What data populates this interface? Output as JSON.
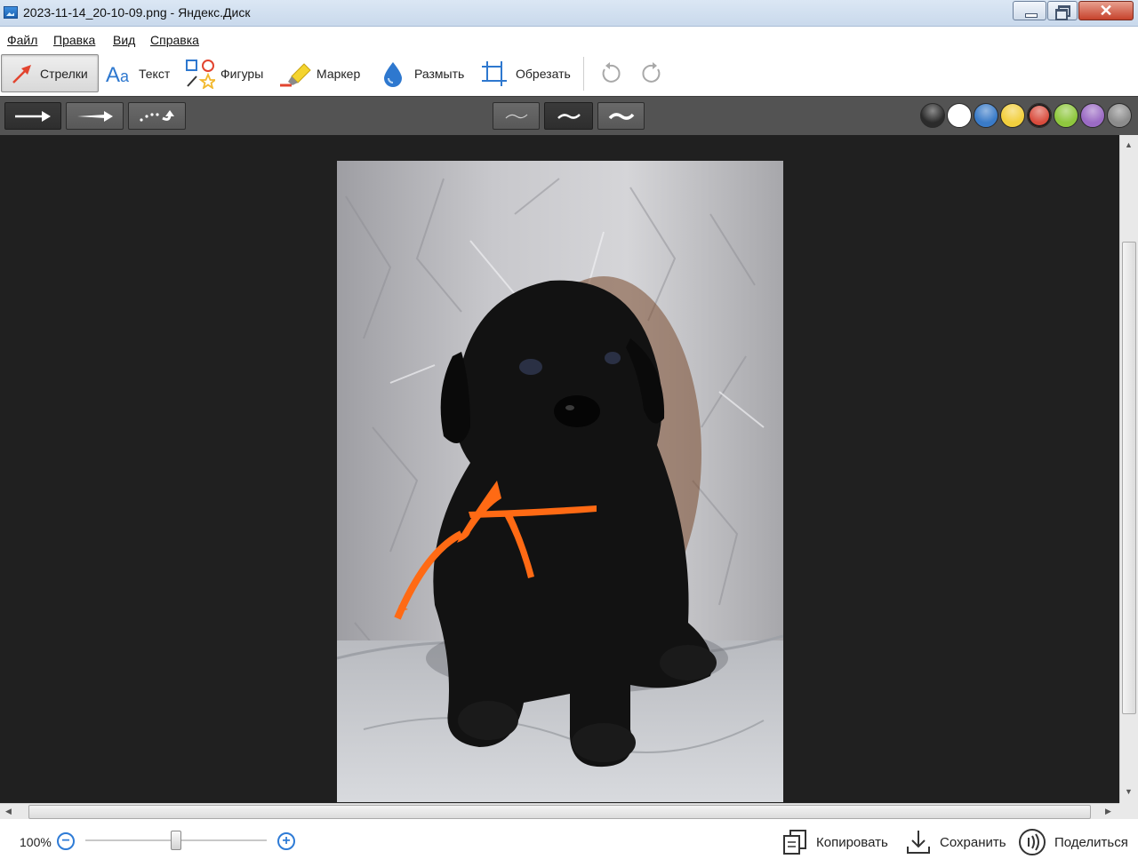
{
  "window": {
    "title": "2023-11-14_20-10-09.png - Яндекс.Диск",
    "close_glyph": "✕"
  },
  "menu": {
    "items": [
      "Файл",
      "Правка",
      "Вид",
      "Справка"
    ]
  },
  "toolbar": {
    "tools": [
      {
        "label": "Стрелки",
        "icon": "arrow-icon",
        "active": true
      },
      {
        "label": "Текст",
        "icon": "text-icon",
        "active": false
      },
      {
        "label": "Фигуры",
        "icon": "shapes-icon",
        "active": false
      },
      {
        "label": "Маркер",
        "icon": "marker-icon",
        "active": false
      },
      {
        "label": "Размыть",
        "icon": "blur-drop-icon",
        "active": false
      },
      {
        "label": "Обрезать",
        "icon": "crop-icon",
        "active": false
      }
    ],
    "history": [
      "undo-icon",
      "redo-icon"
    ]
  },
  "options": {
    "arrow_styles": [
      "straight-arrow",
      "tapered-arrow",
      "dotted-curve-arrow"
    ],
    "selected_arrow_style": 0,
    "line_widths": [
      "thin",
      "medium",
      "thick"
    ],
    "selected_line_width": 1,
    "colors": [
      "#2b2b2b",
      "#ffffff",
      "#3a7bc8",
      "#f2cf3e",
      "#d94b3c",
      "#8fc73e",
      "#9b6bc4",
      "#8c8c8c"
    ],
    "selected_color": 4
  },
  "image": {
    "subject": "black-puppy-photo",
    "background_color": "#bfbfc0"
  },
  "statusbar": {
    "zoom": "100%",
    "zoom_minus": "−",
    "zoom_plus": "+",
    "actions": [
      {
        "label": "Копировать",
        "icon": "copy-icon"
      },
      {
        "label": "Сохранить",
        "icon": "download-icon"
      },
      {
        "label": "Поделиться",
        "icon": "share-icon"
      }
    ]
  }
}
